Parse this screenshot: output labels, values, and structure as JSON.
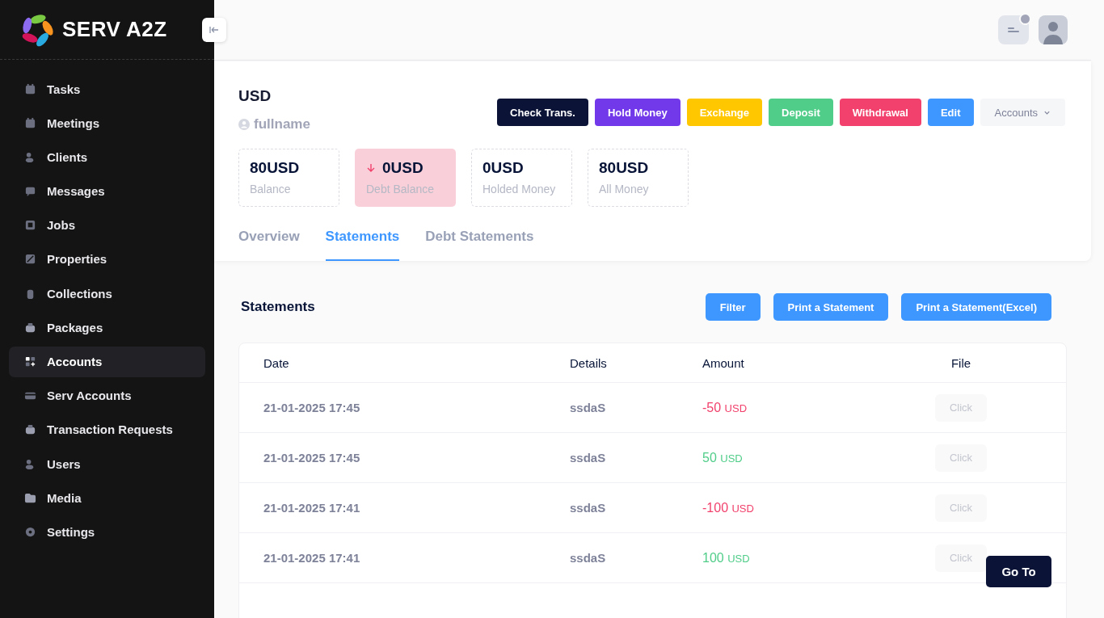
{
  "brand": {
    "name": "SERV A2Z"
  },
  "sidebar": {
    "items": [
      {
        "label": "Tasks",
        "selected": false
      },
      {
        "label": "Meetings",
        "selected": false
      },
      {
        "label": "Clients",
        "selected": false
      },
      {
        "label": "Messages",
        "selected": false
      },
      {
        "label": "Jobs",
        "selected": false
      },
      {
        "label": "Properties",
        "selected": false
      },
      {
        "label": "Collections",
        "selected": false
      },
      {
        "label": "Packages",
        "selected": false
      },
      {
        "label": "Accounts",
        "selected": true
      },
      {
        "label": "Serv Accounts",
        "selected": false
      },
      {
        "label": "Transaction Requests",
        "selected": false
      },
      {
        "label": "Users",
        "selected": false
      },
      {
        "label": "Media",
        "selected": false
      },
      {
        "label": "Settings",
        "selected": false
      }
    ]
  },
  "account": {
    "currency": "USD",
    "owner": "fullname",
    "actions": [
      {
        "label": "Check Trans.",
        "color": "#0b1437"
      },
      {
        "label": "Hold Money",
        "color": "#7239ea"
      },
      {
        "label": "Exchange",
        "color": "#ffc700"
      },
      {
        "label": "Deposit",
        "color": "#50cd89"
      },
      {
        "label": "Withdrawal",
        "color": "#f1416c"
      },
      {
        "label": "Edit",
        "color": "#3e97ff"
      }
    ],
    "dropdown": {
      "label": "Accounts"
    },
    "stats": [
      {
        "value": "80USD",
        "label": "Balance",
        "kind": "plain"
      },
      {
        "value": "0USD",
        "label": "Debt Balance",
        "kind": "debt"
      },
      {
        "value": "0USD",
        "label": "Holded Money",
        "kind": "plain"
      },
      {
        "value": "80USD",
        "label": "All Money",
        "kind": "plain"
      }
    ],
    "tabs": [
      {
        "label": "Overview",
        "selected": false
      },
      {
        "label": "Statements",
        "selected": true
      },
      {
        "label": "Debt Statements",
        "selected": false
      }
    ]
  },
  "statements": {
    "title": "Statements",
    "buttons": [
      "Filter",
      "Print a Statement",
      "Print a Statement(Excel)"
    ],
    "table": {
      "columns": [
        "Date",
        "Details",
        "Amount",
        "File"
      ],
      "rows": [
        {
          "date": "21-01-2025 17:45",
          "details": "ssdaS",
          "amount": "-50",
          "unit": "USD",
          "kind": "out",
          "file": "Click"
        },
        {
          "date": "21-01-2025 17:45",
          "details": "ssdaS",
          "amount": "50",
          "unit": "USD",
          "kind": "in",
          "file": "Click"
        },
        {
          "date": "21-01-2025 17:41",
          "details": "ssdaS",
          "amount": "-100",
          "unit": "USD",
          "kind": "out",
          "file": "Click"
        },
        {
          "date": "21-01-2025 17:41",
          "details": "ssdaS",
          "amount": "100",
          "unit": "USD",
          "kind": "in",
          "file": "Click"
        }
      ]
    }
  },
  "goto_button": {
    "label": "Go To"
  }
}
